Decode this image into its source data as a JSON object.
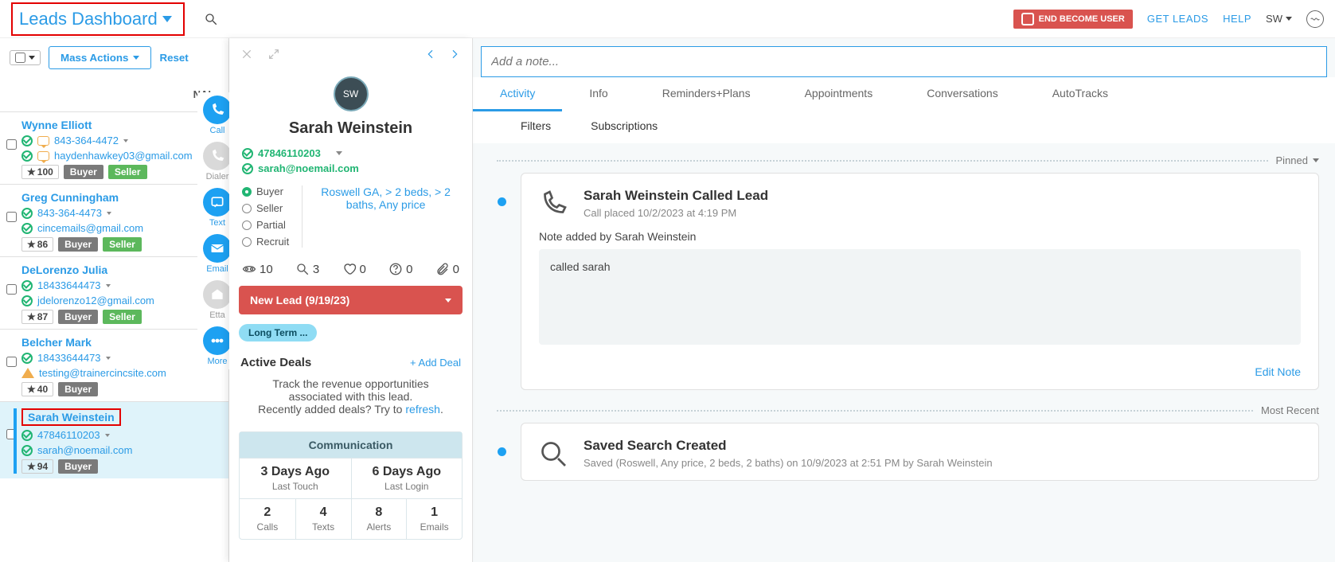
{
  "header": {
    "title": "Leads Dashboard",
    "end_become": "END BECOME USER",
    "get_leads": "GET LEADS",
    "help": "HELP",
    "user": "SW"
  },
  "leads_toolbar": {
    "mass": "Mass Actions",
    "reset": "Reset"
  },
  "name_header": "NAI",
  "leads": [
    {
      "name": "Wynne Elliott",
      "phone": "843-364-4472",
      "email": "haydenhawkey03@gmail.com",
      "score": "100",
      "tags": [
        "Buyer",
        "Seller"
      ],
      "phoneWarn": true,
      "emailWarn": true
    },
    {
      "name": "Greg Cunningham",
      "phone": "843-364-4473",
      "email": "cincemails@gmail.com",
      "score": "86",
      "tags": [
        "Buyer",
        "Seller"
      ]
    },
    {
      "name": "DeLorenzo Julia",
      "phone": "18433644473",
      "email": "jdelorenzo12@gmail.com",
      "score": "87",
      "tags": [
        "Buyer",
        "Seller"
      ]
    },
    {
      "name": "Belcher Mark",
      "phone": "18433644473",
      "email": "testing@trainercincsite.com",
      "score": "40",
      "tags": [
        "Buyer"
      ],
      "emailWarnTri": true
    },
    {
      "name": "Sarah Weinstein",
      "phone": "47846110203",
      "email": "sarah@noemail.com",
      "score": "94",
      "tags": [
        "Buyer"
      ],
      "selected": true
    }
  ],
  "rail": [
    {
      "label": "Call",
      "on": true
    },
    {
      "label": "Dialer",
      "on": false
    },
    {
      "label": "Text",
      "on": true
    },
    {
      "label": "Email",
      "on": true
    },
    {
      "label": "Etta",
      "on": false
    },
    {
      "label": "More",
      "on": true
    }
  ],
  "detail": {
    "initials": "SW",
    "name": "Sarah Weinstein",
    "phone": "47846110203",
    "email": "sarah@noemail.com",
    "types": [
      "Buyer",
      "Seller",
      "Partial",
      "Recruit"
    ],
    "criteria": "Roswell GA, > 2 beds, > 2 baths, Any price",
    "stats": {
      "views": "10",
      "searches": "3",
      "favs": "0",
      "help": "0",
      "attach": "0"
    },
    "status": "New Lead (9/19/23)",
    "chip": "Long Term ...",
    "deals_title": "Active Deals",
    "add_deal": "+  Add Deal",
    "deals_desc": "Track the revenue opportunities associated with this lead.",
    "deals_hint_a": "Recently added deals? Try to ",
    "deals_hint_b": "refresh",
    "comm_title": "Communication",
    "comm": {
      "last_touch_v": "3 Days Ago",
      "last_touch_l": "Last Touch",
      "last_login_v": "6 Days Ago",
      "last_login_l": "Last Login",
      "calls_v": "2",
      "calls_l": "Calls",
      "texts_v": "4",
      "texts_l": "Texts",
      "alerts_v": "8",
      "alerts_l": "Alerts",
      "emails_v": "1",
      "emails_l": "Emails"
    }
  },
  "activity": {
    "note_placeholder": "Add a note...",
    "tabs": [
      "Activity",
      "Info",
      "Reminders+Plans",
      "Appointments",
      "Conversations",
      "AutoTracks"
    ],
    "subtabs": [
      "Filters",
      "Subscriptions"
    ],
    "pinned": "Pinned",
    "recent": "Most Recent",
    "card1": {
      "title": "Sarah Weinstein Called Lead",
      "sub": "Call placed 10/2/2023 at 4:19 PM",
      "note_by": "Note added by Sarah Weinstein",
      "note_txt": "called sarah",
      "edit": "Edit Note"
    },
    "card2": {
      "title": "Saved Search Created",
      "sub": "Saved (Roswell, Any price, 2 beds, 2 baths) on 10/9/2023 at 2:51 PM by Sarah Weinstein"
    }
  }
}
